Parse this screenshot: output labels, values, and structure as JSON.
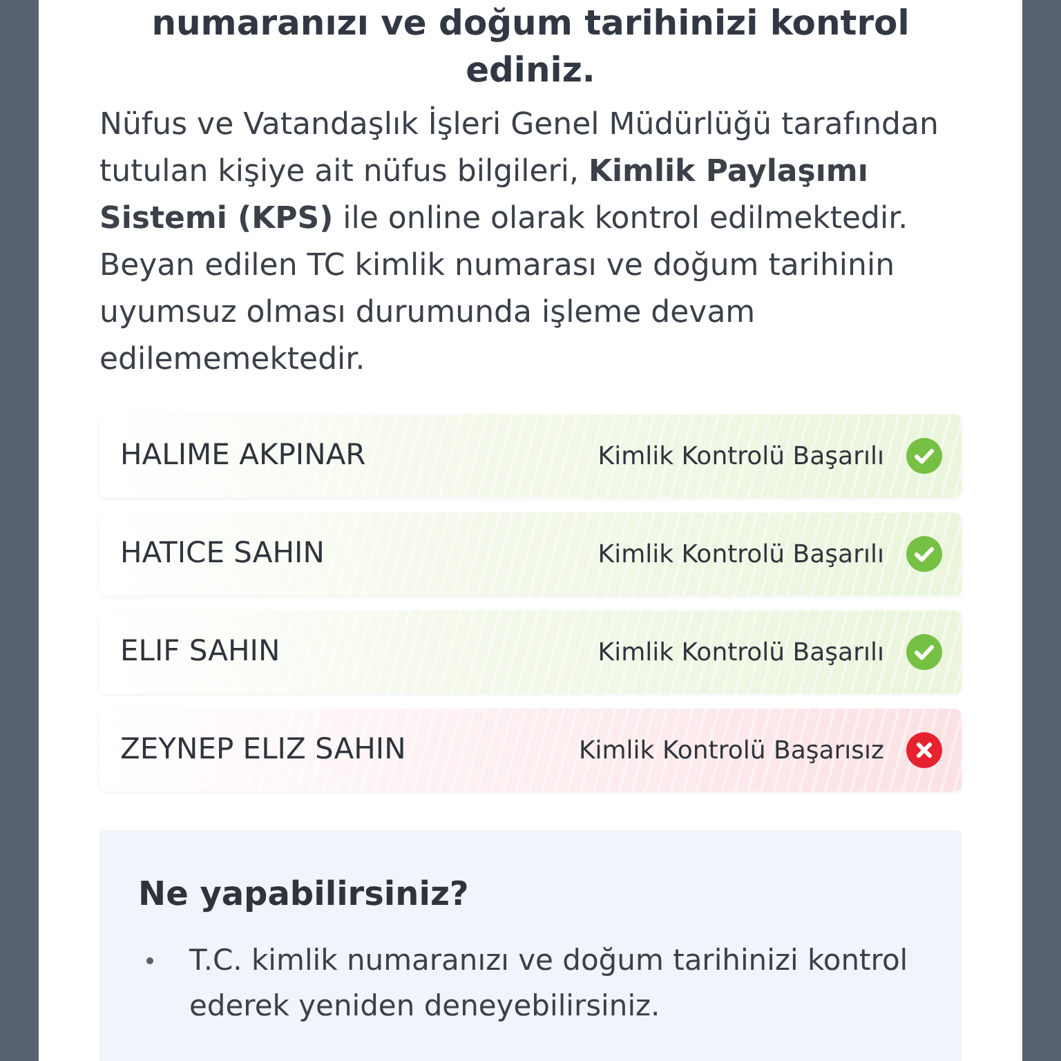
{
  "title": "numaranızı ve doğum tarihinizi kontrol ediniz.",
  "description": "Nüfus ve Vatandaşlık İşleri Genel Müdürlüğü tarafından tutulan kişiye ait nüfus bilgileri, **Kimlik Paylaşımı Sistemi (KPS)** ile online olarak kontrol edilmektedir. Beyan edilen TC kimlik numarası ve doğum tarihinin uyumsuz olması durumunda işleme devam edilememektedir.",
  "results": [
    {
      "name": "HALIME AKPINAR",
      "status": "Kimlik Kontrolü Başarılı",
      "passed": true
    },
    {
      "name": "HATICE SAHIN",
      "status": "Kimlik Kontrolü Başarılı",
      "passed": true
    },
    {
      "name": "ELIF SAHIN",
      "status": "Kimlik Kontrolü Başarılı",
      "passed": true
    },
    {
      "name": "ZEYNEP ELIZ SAHIN",
      "status": "Kimlik Kontrolü Başarısız",
      "passed": false
    }
  ],
  "help": {
    "heading": "Ne yapabilirsiniz?",
    "bullets": [
      "T.C. kimlik numaranızı ve doğum tarihinizi kontrol ederek yeniden deneyebilirsiniz."
    ]
  }
}
